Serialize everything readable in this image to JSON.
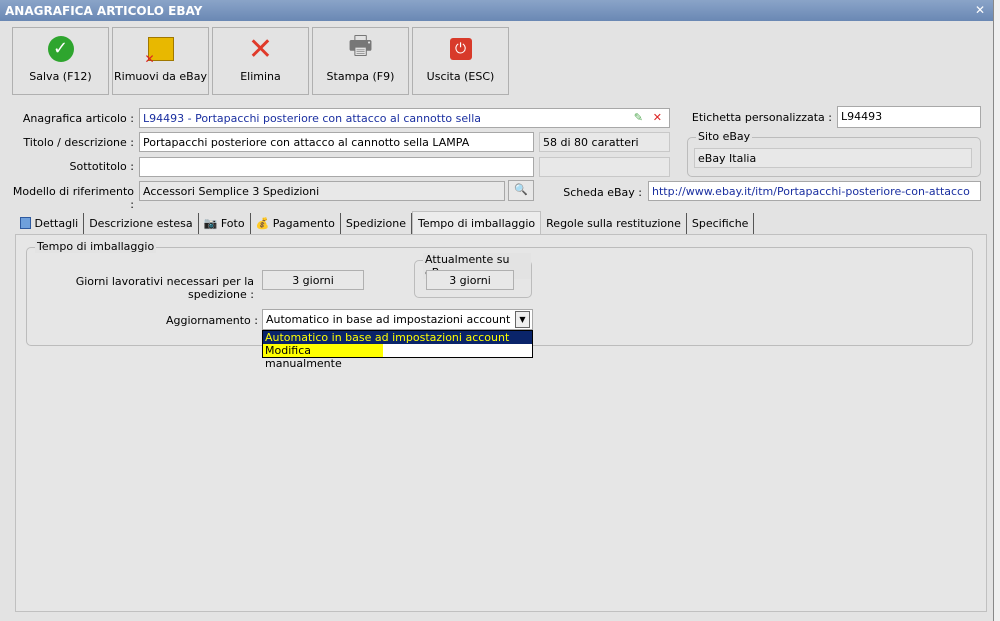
{
  "window": {
    "title": "ANAGRAFICA ARTICOLO EBAY"
  },
  "toolbar": [
    {
      "label": "Salva (F12)",
      "icon": "check-icon"
    },
    {
      "label": "Rimuovi da eBay",
      "icon": "box-remove-icon"
    },
    {
      "label": "Elimina",
      "icon": "delete-x-icon"
    },
    {
      "label": "Stampa (F9)",
      "icon": "printer-icon"
    },
    {
      "label": "Uscita (ESC)",
      "icon": "power-icon"
    }
  ],
  "form": {
    "anagrafica_label": "Anagrafica articolo :",
    "anagrafica_value": "L94493 - Portapacchi posteriore con attacco al cannotto sella",
    "titolo_label": "Titolo / descrizione :",
    "titolo_value": "Portapacchi posteriore con attacco al cannotto sella LAMPA",
    "titolo_count": "58 di 80 caratteri",
    "sottotitolo_label": "Sottotitolo :",
    "sottotitolo_value": "",
    "modello_label": "Modello di riferimento :",
    "modello_value": "Accessori Semplice 3 Spedizioni",
    "etichetta_label": "Etichetta personalizzata :",
    "etichetta_value": "L94493",
    "sito_group": "Sito eBay",
    "sito_value": "eBay Italia",
    "scheda_label": "Scheda eBay :",
    "scheda_value": "http://www.ebay.it/itm/Portapacchi-posteriore-con-attacco"
  },
  "tabs": [
    "Dettagli",
    "Descrizione estesa",
    "Foto",
    "Pagamento",
    "Spedizione",
    "Tempo di imballaggio",
    "Regole sulla restituzione",
    "Specifiche"
  ],
  "panel": {
    "group_title": "Tempo di imballaggio",
    "giorni_label": "Giorni lavorativi necessari per la spedizione :",
    "giorni_value": "3 giorni",
    "ebay_group": "Attualmente su eBay",
    "ebay_value": "3 giorni",
    "aggiornamento_label": "Aggiornamento :",
    "aggiornamento_value": "Automatico in base ad impostazioni account",
    "options": [
      "Automatico in base ad impostazioni account",
      "Modifica manualmente"
    ]
  }
}
